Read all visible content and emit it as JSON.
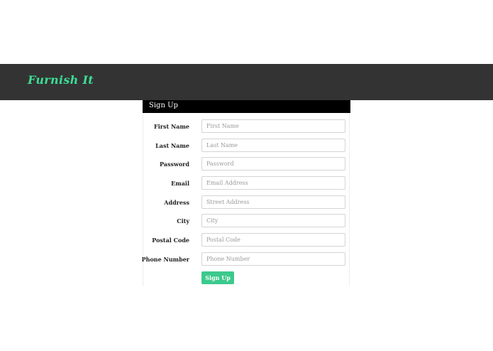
{
  "navbar": {
    "brand": "Furnish It"
  },
  "signup": {
    "title": "Sign Up",
    "fields": [
      {
        "label": "First Name",
        "placeholder": "First Name",
        "value": ""
      },
      {
        "label": "Last Name",
        "placeholder": "Last Name",
        "value": ""
      },
      {
        "label": "Password",
        "placeholder": "Password",
        "value": ""
      },
      {
        "label": "Email",
        "placeholder": "Email Address",
        "value": ""
      },
      {
        "label": "Address",
        "placeholder": "Street Address",
        "value": ""
      },
      {
        "label": "City",
        "placeholder": "City",
        "value": ""
      },
      {
        "label": "Postal Code",
        "placeholder": "Postal Code",
        "value": ""
      },
      {
        "label": "Phone Number",
        "placeholder": "Phone Number",
        "value": ""
      }
    ],
    "submit_label": "Sign Up"
  },
  "colors": {
    "navbar_bg": "#333333",
    "brand": "#3ddc97",
    "header_bg": "#000000",
    "button_bg": "#3cc98d"
  }
}
